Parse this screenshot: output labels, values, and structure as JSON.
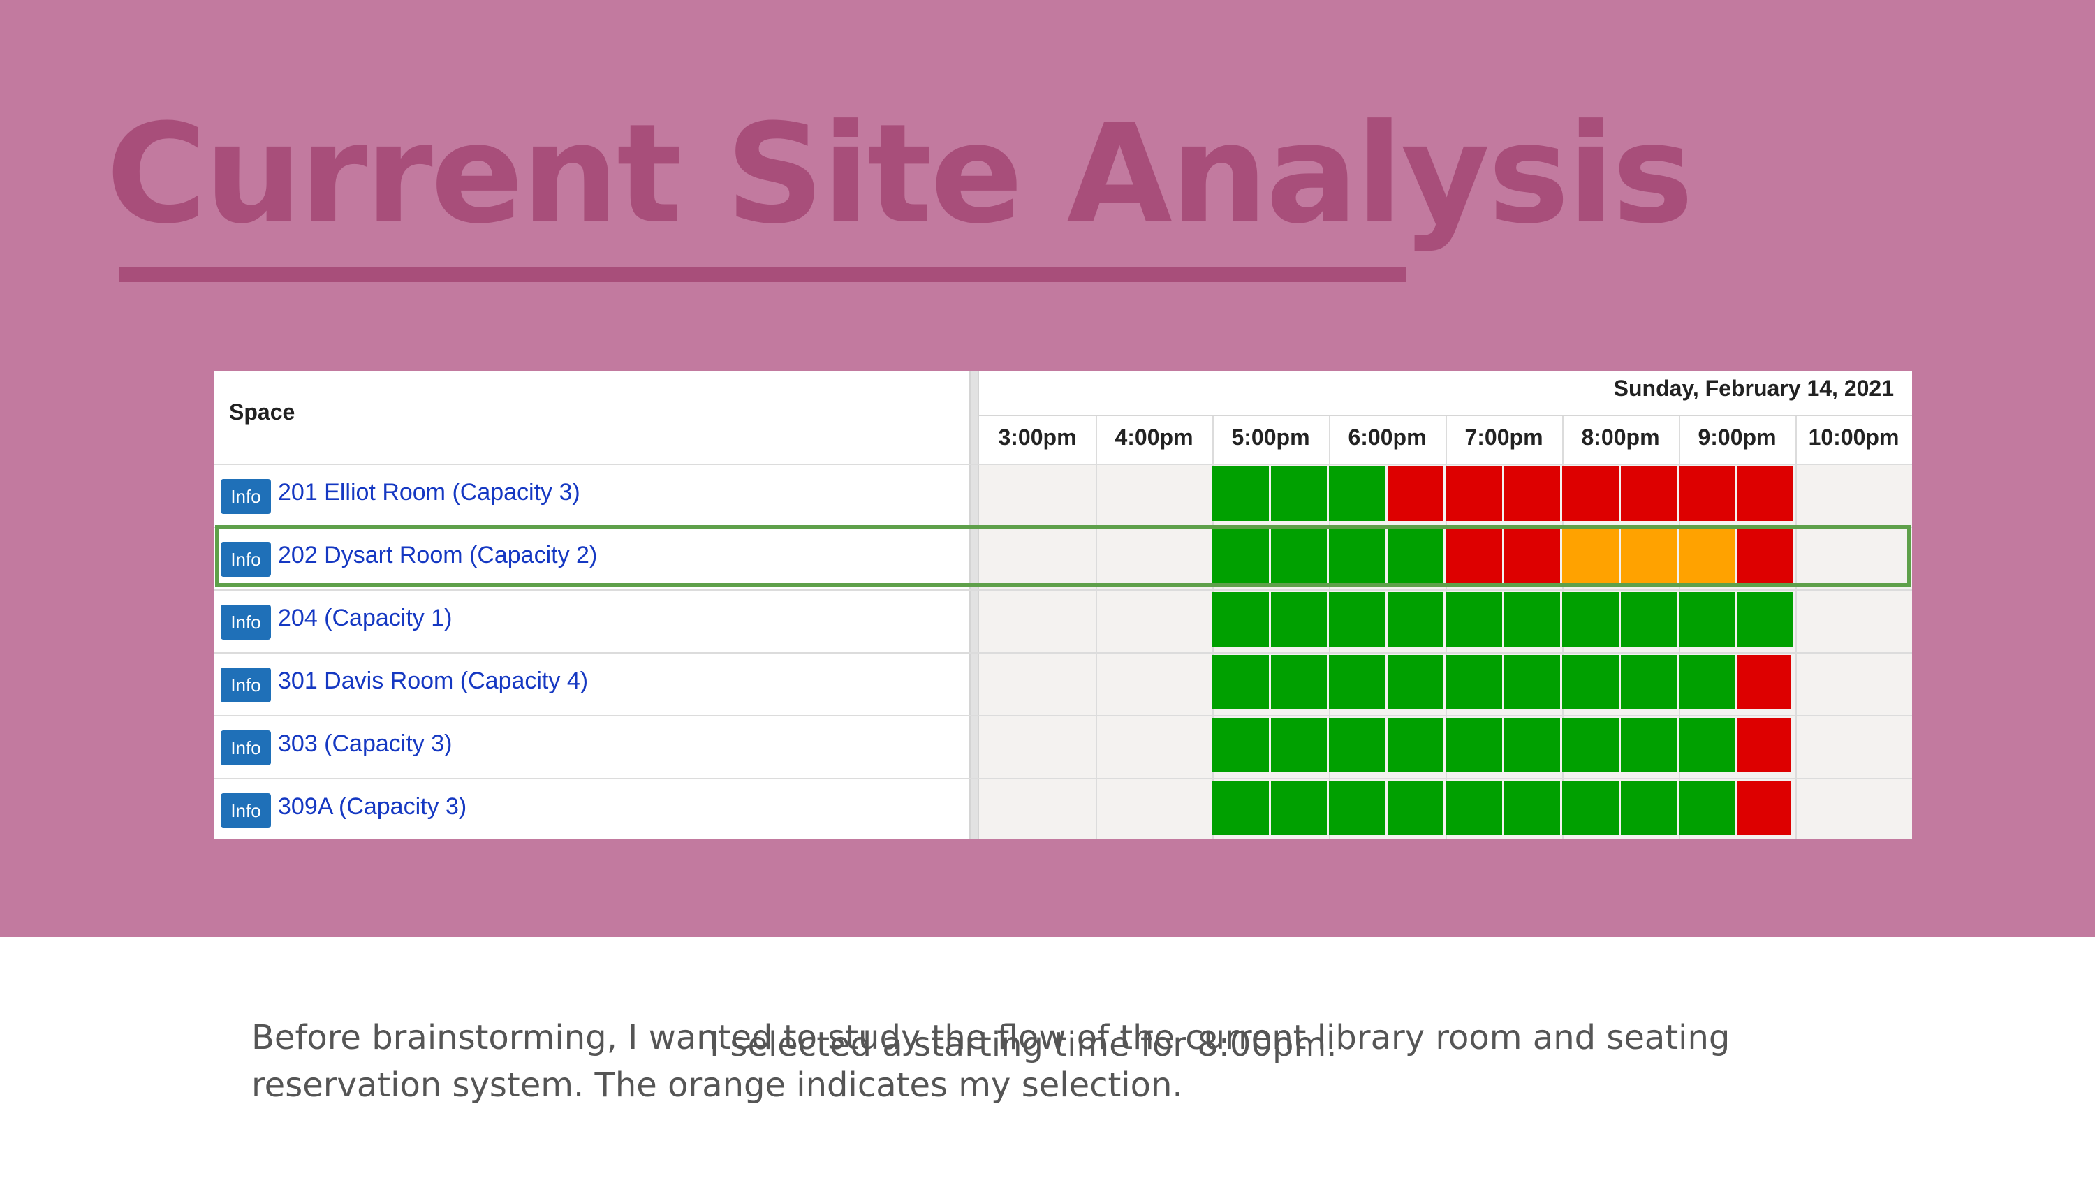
{
  "slide": {
    "title": "Current Site Analysis",
    "body_text": "Before brainstorming, I wanted to study the flow of the current library room and seating reservation system. The orange indicates my selection.",
    "overlay_text": "I selected a starting time for 8:00pm."
  },
  "reservation_grid": {
    "space_header": "Space",
    "date_label": "Sunday, February 14, 2021",
    "info_label": "Info",
    "time_slots": [
      "3:00pm",
      "4:00pm",
      "5:00pm",
      "6:00pm",
      "7:00pm",
      "8:00pm",
      "9:00pm",
      "10:00pm"
    ],
    "rooms": [
      {
        "name": "201 Elliot Room (Capacity 3)",
        "slots": [
          "green",
          "green",
          "green",
          "red",
          "red",
          "red",
          "red",
          "red",
          "red",
          "red"
        ]
      },
      {
        "name": "202 Dysart Room (Capacity 2)",
        "slots": [
          "green",
          "green",
          "green",
          "green",
          "red",
          "red",
          "orange",
          "orange",
          "orange",
          "red"
        ],
        "selected": true
      },
      {
        "name": "204 (Capacity 1)",
        "slots": [
          "green",
          "green",
          "green",
          "green",
          "green",
          "green",
          "green",
          "green",
          "green",
          "green"
        ]
      },
      {
        "name": "301 Davis Room (Capacity 4)",
        "slots": [
          "green",
          "green",
          "green",
          "green",
          "green",
          "green",
          "green",
          "green",
          "green",
          "red"
        ]
      },
      {
        "name": "303 (Capacity 3)",
        "slots": [
          "green",
          "green",
          "green",
          "green",
          "green",
          "green",
          "green",
          "green",
          "green",
          "red"
        ]
      },
      {
        "name": "309A (Capacity 3)",
        "slots": [
          "green",
          "green",
          "green",
          "green",
          "green",
          "green",
          "green",
          "green",
          "green",
          "red"
        ]
      }
    ],
    "colors": {
      "green": "#00a000",
      "red": "#dd0000",
      "orange": "#ffa200",
      "selection_border": "#5ea04a",
      "info_button": "#1f70b8",
      "link": "#1538c2"
    }
  }
}
